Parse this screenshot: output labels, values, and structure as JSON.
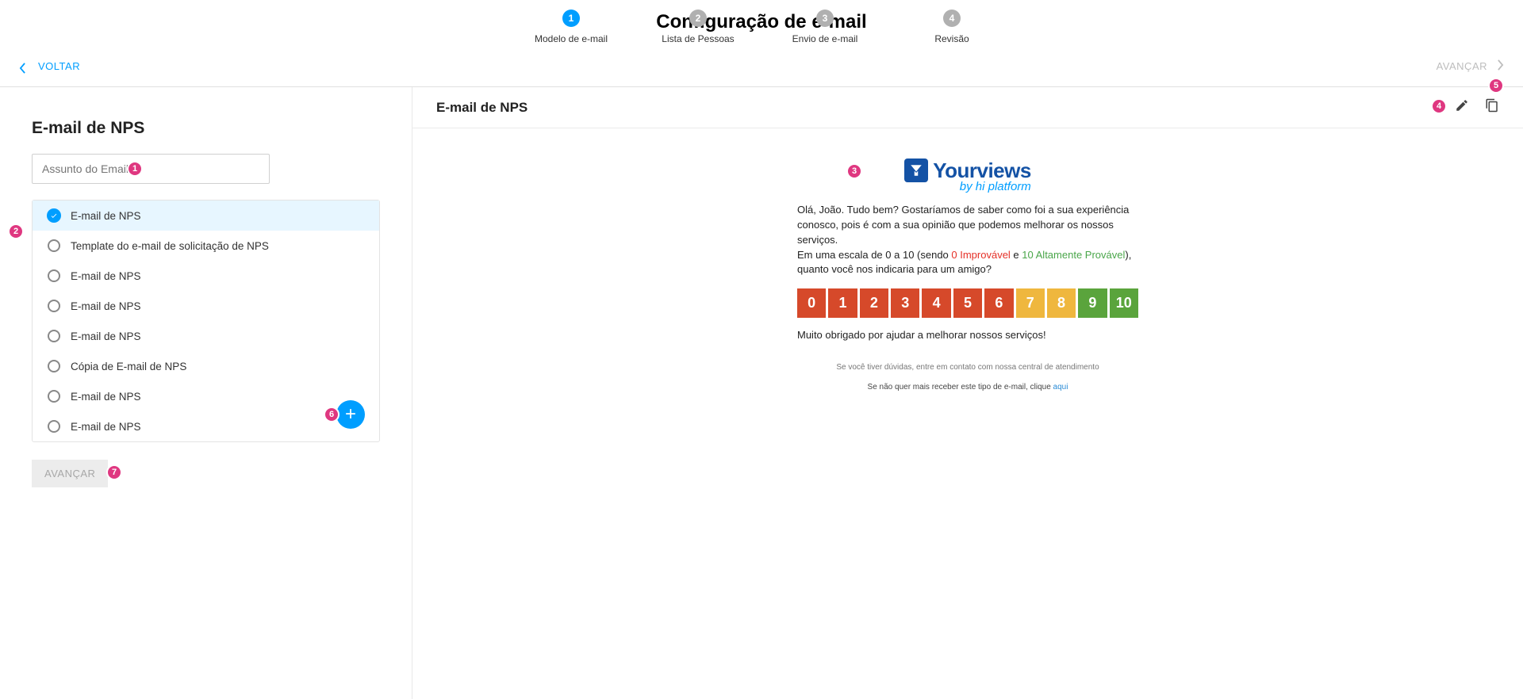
{
  "page_title": "Configuração de e-mail",
  "nav": {
    "back": "VOLTAR",
    "forward": "AVANÇAR"
  },
  "stepper": [
    {
      "num": "1",
      "label": "Modelo de e-mail",
      "active": true
    },
    {
      "num": "2",
      "label": "Lista de Pessoas",
      "active": false
    },
    {
      "num": "3",
      "label": "Envio de e-mail",
      "active": false
    },
    {
      "num": "4",
      "label": "Revisão",
      "active": false
    }
  ],
  "left": {
    "heading": "E-mail de NPS",
    "subject_placeholder": "Assunto do Email *",
    "advance": "AVANÇAR",
    "templates": [
      "E-mail de NPS",
      "Template do e-mail de solicitação de NPS",
      "E-mail de NPS",
      "E-mail de NPS",
      "E-mail de NPS",
      "Cópia de E-mail de NPS",
      "E-mail de NPS",
      "E-mail de NPS"
    ]
  },
  "preview": {
    "title": "E-mail de NPS",
    "logo_main": "Yourviews",
    "logo_sub": "by hi platform",
    "greeting": "Olá, João. Tudo bem? Gostaríamos de saber como foi a sua experiência conosco, pois é com a sua opinião que podemos melhorar os nossos serviços.",
    "scale_pre": "Em uma escala de 0 a 10 (sendo ",
    "improv": "0 Improvável",
    "scale_mid": " e ",
    "prov": "10 Altamente Provável",
    "scale_post": "), quanto você nos indicaria para um amigo?",
    "nps": [
      {
        "v": "0",
        "c": "#d6492a"
      },
      {
        "v": "1",
        "c": "#d6492a"
      },
      {
        "v": "2",
        "c": "#d6492a"
      },
      {
        "v": "3",
        "c": "#d6492a"
      },
      {
        "v": "4",
        "c": "#d6492a"
      },
      {
        "v": "5",
        "c": "#d6492a"
      },
      {
        "v": "6",
        "c": "#d6492a"
      },
      {
        "v": "7",
        "c": "#efb73e"
      },
      {
        "v": "8",
        "c": "#efb73e"
      },
      {
        "v": "9",
        "c": "#5aa43c"
      },
      {
        "v": "10",
        "c": "#5aa43c"
      }
    ],
    "thanks": "Muito obrigado por ajudar a melhorar nossos serviços!",
    "footer1": "Se você tiver dúvidas, entre em contato com nossa central de atendimento",
    "footer2_pre": "Se não quer mais receber este tipo de e-mail, clique ",
    "footer2_link": "aqui"
  },
  "markers": [
    "1",
    "2",
    "3",
    "4",
    "5",
    "6",
    "7"
  ]
}
